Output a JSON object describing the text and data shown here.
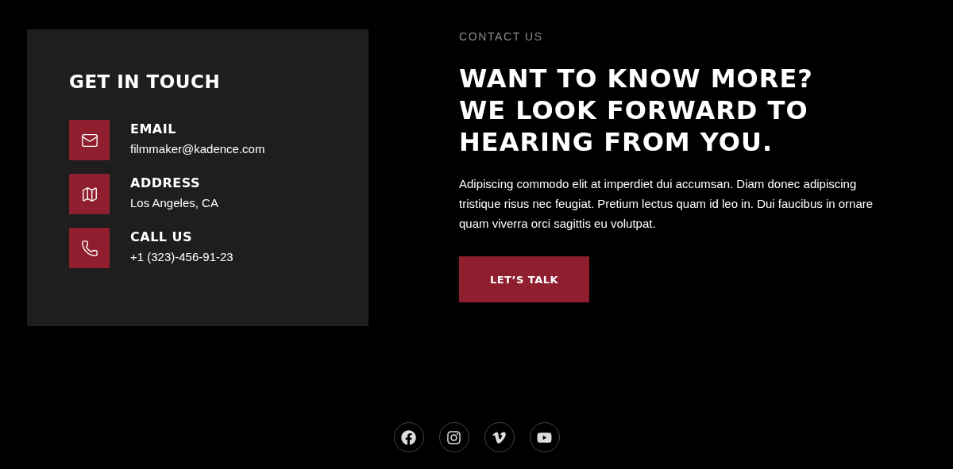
{
  "contact_card": {
    "title": "GET IN TOUCH",
    "items": [
      {
        "kind": "email",
        "label": "EMAIL",
        "value": "filmmaker@kadence.com"
      },
      {
        "kind": "address",
        "label": "ADDRESS",
        "value": "Los Angeles, CA"
      },
      {
        "kind": "phone",
        "label": "CALL US",
        "value": "+1 (323)-456-91-23"
      }
    ]
  },
  "intro": {
    "eyebrow": "CONTACT US",
    "headline": [
      "WANT TO KNOW MORE?",
      "WE LOOK FORWARD TO",
      "HEARING FROM YOU."
    ],
    "body": "Adipiscing commodo elit at imperdiet dui accumsan. Diam donec adipiscing tristique risus nec feugiat. Pretium lectus quam id leo in. Dui faucibus in ornare quam viverra orci sagittis eu volutpat.",
    "button": "LET’S TALK"
  },
  "social_links": [
    {
      "kind": "facebook"
    },
    {
      "kind": "instagram"
    },
    {
      "kind": "vimeo"
    },
    {
      "kind": "youtube"
    }
  ]
}
